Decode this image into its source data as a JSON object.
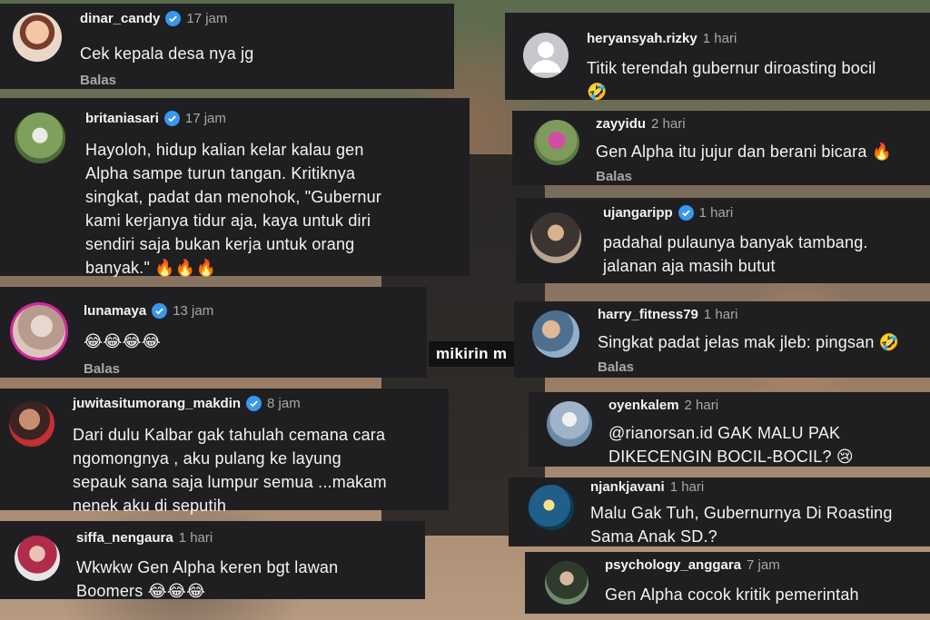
{
  "overlay_caption": "mikirin m",
  "comments": [
    {
      "username": "dinar_candy",
      "verified": true,
      "time": "17 jam",
      "text": "Cek kepala desa nya jg",
      "reply": "Balas"
    },
    {
      "username": "britaniasari",
      "verified": true,
      "time": "17 jam",
      "lines": [
        "Hayoloh, hidup kalian kelar kalau gen",
        "Alpha sampe turun tangan. Kritiknya",
        "singkat, padat dan menohok, \"Gubernur",
        "kami kerjanya tidur aja, kaya untuk diri",
        "sendiri saja bukan kerja untuk orang",
        "banyak.\" 🔥🔥🔥"
      ]
    },
    {
      "username": "lunamaya",
      "verified": true,
      "time": "13 jam",
      "text": "😂😂😂😂",
      "reply": "Balas"
    },
    {
      "username": "juwitasitumorang_makdin",
      "verified": true,
      "time": "8 jam",
      "lines": [
        "Dari dulu Kalbar gak tahulah cemana cara",
        "ngomongnya , aku pulang ke layung",
        "sepauk sana saja lumpur semua ...makam",
        "nenek aku di seputih"
      ]
    },
    {
      "username": "siffa_nengaura",
      "verified": false,
      "time": "1 hari",
      "lines": [
        "Wkwkw Gen Alpha keren bgt lawan",
        "Boomers 😂😂😂"
      ]
    },
    {
      "username": "heryansyah.rizky",
      "verified": false,
      "time": "1 hari",
      "lines": [
        "Titik terendah gubernur diroasting bocil",
        "🤣"
      ]
    },
    {
      "username": "zayyidu",
      "verified": false,
      "time": "2 hari",
      "text": "Gen Alpha itu jujur dan berani bicara 🔥",
      "reply": "Balas"
    },
    {
      "username": "ujangaripp",
      "verified": true,
      "time": "1 hari",
      "lines": [
        "padahal pulaunya banyak tambang.",
        "jalanan aja masih butut"
      ]
    },
    {
      "username": "harry_fitness79",
      "verified": false,
      "time": "1 hari",
      "text": "Singkat padat jelas mak jleb: pingsan 🤣",
      "reply": "Balas"
    },
    {
      "username": "oyenkalem",
      "verified": false,
      "time": "2 hari",
      "lines": [
        "@rianorsan.id GAK MALU PAK",
        "DIKECENGIN BOCIL-BOCIL? 😢"
      ]
    },
    {
      "username": "njankjavani",
      "verified": false,
      "time": "1 hari",
      "lines": [
        "Malu Gak Tuh, Gubernurnya Di Roasting",
        "Sama Anak SD.?"
      ]
    },
    {
      "username": "psychology_anggara",
      "verified": false,
      "time": "7 jam",
      "text": "Gen Alpha cocok kritik pemerintah"
    }
  ]
}
